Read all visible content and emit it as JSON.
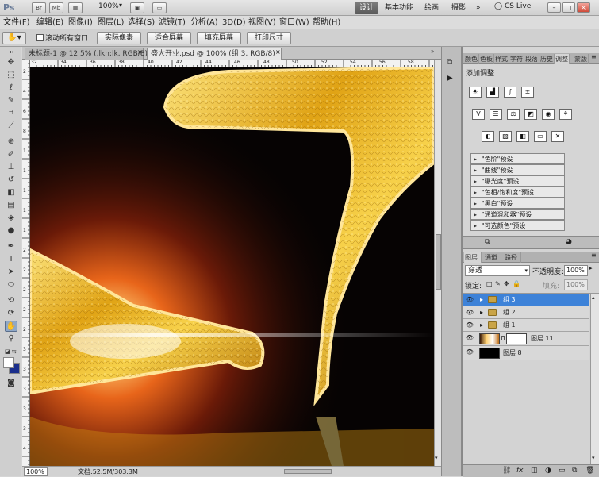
{
  "titlebar": {
    "app_logo": "Ps",
    "buttons": [
      "Br",
      "Mb"
    ],
    "zoom": "100%",
    "workspaces": [
      "设计",
      "基本功能",
      "绘画",
      "摄影"
    ],
    "more": "»",
    "cs_live": "CS Live",
    "window_controls": [
      "–",
      "□",
      "×"
    ]
  },
  "menubar": {
    "items": [
      "文件(F)",
      "编辑(E)",
      "图像(I)",
      "图层(L)",
      "选择(S)",
      "滤镜(T)",
      "分析(A)",
      "3D(D)",
      "视图(V)",
      "窗口(W)",
      "帮助(H)"
    ]
  },
  "options": {
    "scroll_all": "滚动所有窗口",
    "actual_pixels": "实际像素",
    "fit_screen": "适合屏幕",
    "fill_screen": "填充屏幕",
    "print_size": "打印尺寸"
  },
  "doc_tabs": [
    {
      "label": "未标题-1 @ 12.5% (,lkn;lk, RGB/8) *"
    },
    {
      "label": "盛大开业.psd @ 100% (组 3, RGB/8)"
    }
  ],
  "rulers": {
    "h_ticks": [
      "32",
      "34",
      "36",
      "38",
      "40",
      "42",
      "44",
      "46",
      "48",
      "50",
      "52",
      "54",
      "56",
      "58"
    ],
    "v_ticks": [
      "2",
      "4",
      "6",
      "8",
      "1",
      "1",
      "1",
      "1",
      "1",
      "2",
      "2",
      "2",
      "2",
      "2",
      "3",
      "3",
      "3",
      "3",
      "3",
      "4"
    ]
  },
  "status": {
    "zoom": "100%",
    "doc_info": "文档:52.5M/303.3M"
  },
  "adjustments": {
    "tabs": [
      "颜色",
      "色板",
      "样式",
      "字符",
      "段落",
      "历史",
      "调整",
      "蒙版"
    ],
    "active_tab": "调整",
    "title": "添加调整",
    "row1_icons": [
      "brightness-icon",
      "levels-icon",
      "curves-icon",
      "exposure-icon"
    ],
    "row2_icons": [
      "vibrance-icon",
      "hue-icon",
      "color-balance-icon",
      "bw-icon",
      "photo-filter-icon",
      "channel-mixer-icon"
    ],
    "row3_icons": [
      "invert-icon",
      "posterize-icon",
      "threshold-icon",
      "gradient-map-icon",
      "selective-color-icon"
    ],
    "presets": [
      "\"色阶\"预设",
      "\"曲线\"预设",
      "\"曝光度\"预设",
      "\"色相/饱和度\"预设",
      "\"黑白\"预设",
      "\"通道混和器\"预设",
      "\"可选颜色\"预设"
    ]
  },
  "layers": {
    "tabs": [
      "图层",
      "通道",
      "路径"
    ],
    "blend_mode": "穿透",
    "opacity_label": "不透明度:",
    "opacity_value": "100%",
    "lock_label": "锁定:",
    "fill_label": "填充:",
    "fill_value": "100%",
    "items": [
      {
        "name": "组 3",
        "type": "group",
        "selected": true
      },
      {
        "name": "组 2",
        "type": "group",
        "selected": false
      },
      {
        "name": "组 1",
        "type": "group",
        "selected": false
      },
      {
        "name": "图层 11",
        "type": "masked",
        "selected": false
      },
      {
        "name": "图层 8",
        "type": "layer",
        "selected": false
      }
    ],
    "bottom_icons": [
      "link-icon",
      "fx-icon",
      "mask-icon",
      "adjustment-icon",
      "folder-icon",
      "new-layer-icon",
      "trash-icon"
    ]
  },
  "colors": {
    "selection": "#3d82d8",
    "canvas_bg": "#060303",
    "gold": "#e8b21c",
    "foreground": "#000000",
    "background": "#ffffff"
  }
}
